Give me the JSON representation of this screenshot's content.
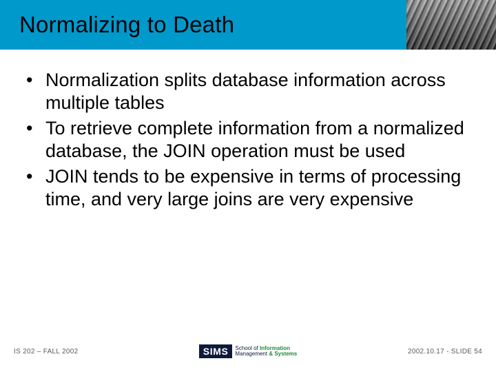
{
  "title": "Normalizing to Death",
  "bullets": [
    "Normalization splits database information across multiple tables",
    "To retrieve complete information from a normalized database, the JOIN operation must be used",
    "JOIN tends to be expensive in terms of processing time, and very large joins are very expensive"
  ],
  "footer": {
    "left": "IS 202 – FALL 2002",
    "right": "2002.10.17 - SLIDE 54",
    "logo_primary": "SIMS",
    "logo_line1_a": "School of ",
    "logo_line1_b": "Information",
    "logo_line2_a": "Management ",
    "logo_line2_amp": "& ",
    "logo_line2_b": "Systems"
  }
}
